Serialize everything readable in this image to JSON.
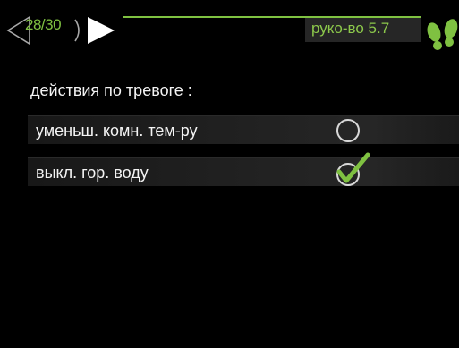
{
  "header": {
    "page_indicator": "28/30",
    "menu_label": "руко-во 5.7",
    "accent_color": "#7fc141",
    "prev_icon": "triangle-left-outline-icon",
    "next_icon": "triangle-right-filled-icon",
    "logo_icon": "footprints-icon"
  },
  "main": {
    "section_title": "действия по тревоге :",
    "options": [
      {
        "label": "уменьш. комн. тем-ру",
        "checked": false,
        "icon": "radio-unchecked-icon"
      },
      {
        "label": "выкл. гор. воду",
        "checked": true,
        "icon": "checkmark-checked-icon"
      }
    ]
  }
}
